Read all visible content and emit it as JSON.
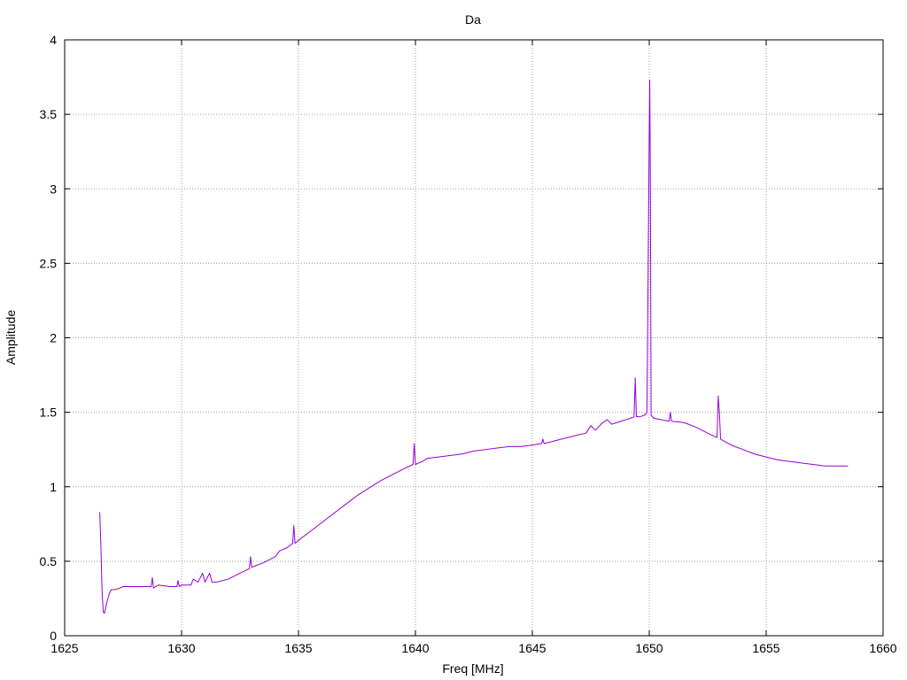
{
  "chart_data": {
    "type": "line",
    "title": "Da",
    "xlabel": "Freq [MHz]",
    "ylabel": "Amplitude",
    "xlim": [
      1625,
      1660
    ],
    "ylim": [
      0,
      4
    ],
    "xticks": [
      "1625",
      "1630",
      "1635",
      "1640",
      "1645",
      "1650",
      "1655",
      "1660"
    ],
    "yticks": [
      "0",
      "0.5",
      "1",
      "1.5",
      "2",
      "2.5",
      "3",
      "3.5",
      "4"
    ],
    "grid": true,
    "legend": "none",
    "series": [
      {
        "color": "#9400d3",
        "points": [
          [
            1626.5,
            0.83
          ],
          [
            1626.55,
            0.6
          ],
          [
            1626.6,
            0.3
          ],
          [
            1626.65,
            0.16
          ],
          [
            1626.7,
            0.15
          ],
          [
            1626.8,
            0.22
          ],
          [
            1626.9,
            0.28
          ],
          [
            1627.0,
            0.31
          ],
          [
            1627.2,
            0.31
          ],
          [
            1627.5,
            0.33
          ],
          [
            1628.0,
            0.33
          ],
          [
            1628.5,
            0.33
          ],
          [
            1628.7,
            0.33
          ],
          [
            1628.75,
            0.39
          ],
          [
            1628.8,
            0.32
          ],
          [
            1629.0,
            0.34
          ],
          [
            1629.5,
            0.33
          ],
          [
            1629.8,
            0.33
          ],
          [
            1629.85,
            0.37
          ],
          [
            1629.9,
            0.33
          ],
          [
            1630.0,
            0.34
          ],
          [
            1630.4,
            0.34
          ],
          [
            1630.5,
            0.38
          ],
          [
            1630.7,
            0.36
          ],
          [
            1630.9,
            0.42
          ],
          [
            1631.0,
            0.36
          ],
          [
            1631.2,
            0.42
          ],
          [
            1631.3,
            0.36
          ],
          [
            1631.5,
            0.36
          ],
          [
            1632.0,
            0.38
          ],
          [
            1632.5,
            0.42
          ],
          [
            1632.9,
            0.45
          ],
          [
            1632.95,
            0.53
          ],
          [
            1633.0,
            0.46
          ],
          [
            1633.5,
            0.49
          ],
          [
            1634.0,
            0.53
          ],
          [
            1634.2,
            0.57
          ],
          [
            1634.5,
            0.59
          ],
          [
            1634.75,
            0.62
          ],
          [
            1634.8,
            0.74
          ],
          [
            1634.85,
            0.62
          ],
          [
            1635.0,
            0.64
          ],
          [
            1635.5,
            0.7
          ],
          [
            1636.0,
            0.76
          ],
          [
            1636.5,
            0.82
          ],
          [
            1637.0,
            0.88
          ],
          [
            1637.5,
            0.94
          ],
          [
            1638.0,
            0.99
          ],
          [
            1638.5,
            1.04
          ],
          [
            1639.0,
            1.08
          ],
          [
            1639.5,
            1.12
          ],
          [
            1639.9,
            1.15
          ],
          [
            1639.95,
            1.29
          ],
          [
            1640.0,
            1.15
          ],
          [
            1640.3,
            1.17
          ],
          [
            1640.5,
            1.19
          ],
          [
            1641.0,
            1.2
          ],
          [
            1641.5,
            1.21
          ],
          [
            1642.0,
            1.22
          ],
          [
            1642.5,
            1.24
          ],
          [
            1643.0,
            1.25
          ],
          [
            1643.5,
            1.26
          ],
          [
            1644.0,
            1.27
          ],
          [
            1644.5,
            1.27
          ],
          [
            1645.0,
            1.28
          ],
          [
            1645.4,
            1.29
          ],
          [
            1645.45,
            1.32
          ],
          [
            1645.5,
            1.29
          ],
          [
            1646.0,
            1.31
          ],
          [
            1646.5,
            1.33
          ],
          [
            1647.0,
            1.35
          ],
          [
            1647.3,
            1.36
          ],
          [
            1647.5,
            1.41
          ],
          [
            1647.7,
            1.38
          ],
          [
            1648.0,
            1.43
          ],
          [
            1648.2,
            1.45
          ],
          [
            1648.4,
            1.42
          ],
          [
            1648.6,
            1.43
          ],
          [
            1648.8,
            1.44
          ],
          [
            1649.0,
            1.45
          ],
          [
            1649.2,
            1.46
          ],
          [
            1649.35,
            1.47
          ],
          [
            1649.4,
            1.73
          ],
          [
            1649.45,
            1.47
          ],
          [
            1649.6,
            1.47
          ],
          [
            1649.8,
            1.48
          ],
          [
            1649.9,
            1.5
          ],
          [
            1649.95,
            2.4
          ],
          [
            1650.0,
            3.4
          ],
          [
            1650.02,
            3.73
          ],
          [
            1650.05,
            3.0
          ],
          [
            1650.08,
            1.48
          ],
          [
            1650.2,
            1.46
          ],
          [
            1650.5,
            1.45
          ],
          [
            1650.85,
            1.44
          ],
          [
            1650.9,
            1.5
          ],
          [
            1650.95,
            1.44
          ],
          [
            1651.5,
            1.43
          ],
          [
            1652.0,
            1.4
          ],
          [
            1652.5,
            1.36
          ],
          [
            1652.9,
            1.33
          ],
          [
            1652.95,
            1.61
          ],
          [
            1653.0,
            1.5
          ],
          [
            1653.05,
            1.32
          ],
          [
            1653.5,
            1.28
          ],
          [
            1654.0,
            1.25
          ],
          [
            1654.5,
            1.22
          ],
          [
            1655.0,
            1.2
          ],
          [
            1655.5,
            1.18
          ],
          [
            1656.0,
            1.17
          ],
          [
            1656.5,
            1.16
          ],
          [
            1657.0,
            1.15
          ],
          [
            1657.5,
            1.14
          ],
          [
            1658.0,
            1.14
          ],
          [
            1658.5,
            1.14
          ]
        ]
      }
    ]
  }
}
